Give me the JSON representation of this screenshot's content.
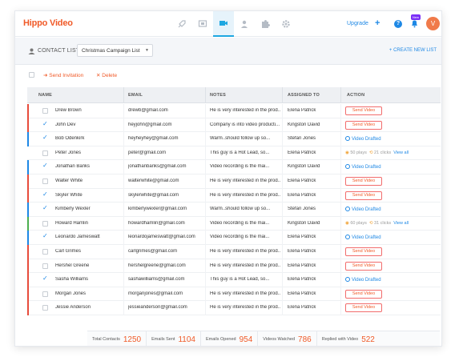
{
  "app": {
    "logo": "Hippo Video"
  },
  "topbar": {
    "nav_icons": [
      "rocket-icon",
      "screen-icon",
      "video-camera-icon",
      "contacts-icon",
      "puzzle-icon",
      "gear-icon"
    ],
    "upgrade": "Upgrade",
    "add": "+",
    "help": "?",
    "new_badge": "New",
    "avatar": "V",
    "accent": "#1ea7e1",
    "brand": "#f05a28"
  },
  "subheader": {
    "contact_list_label": "CONTACT LIST",
    "selected_list": "Christmas Campaign List",
    "create_new": "+ CREATE NEW LIST"
  },
  "actions": {
    "send_invitation": "Send Invitation",
    "delete": "Delete"
  },
  "table": {
    "columns": [
      "NAME",
      "EMAIL",
      "NOTES",
      "ASSIGNED TO",
      "ACTION"
    ],
    "rows": [
      {
        "name": "Drew Brown",
        "email": "drewb@gmail.com",
        "notes": "He is very interested in the prod...",
        "assigned": "Elena Patrick",
        "checked": false,
        "action": "send",
        "bar": "#e74c3c"
      },
      {
        "name": "John Dev",
        "email": "heyjohn@gmail.com",
        "notes": "Company is into video producti...",
        "assigned": "Kingston David",
        "checked": true,
        "action": "send",
        "bar": "#e74c3c"
      },
      {
        "name": "Bob Odenkirk",
        "email": "heyheyhey@gmail.com",
        "notes": "Warm..should follow up so...",
        "assigned": "Stefan Jones",
        "checked": true,
        "action": "drafted",
        "bar": "#1e88e5"
      },
      {
        "name": "Peter Jones",
        "email": "peter@gmail.com",
        "notes": "This guy is a Hot Lead, so...",
        "assigned": "Elena Patrick",
        "checked": false,
        "action": "stats",
        "plays": "50 plays",
        "clicks": "21 clicks",
        "bar": ""
      },
      {
        "name": "Jonathan Banks",
        "email": "jonathanbanks@gmail.com",
        "notes": "Video recording is the mai...",
        "assigned": "Kingston David",
        "checked": true,
        "action": "drafted",
        "bar": "#1e88e5"
      },
      {
        "name": "Walter White",
        "email": "walterwhite@gmail.com",
        "notes": "He is very interested in the prod...",
        "assigned": "Elena Patrick",
        "checked": false,
        "action": "send",
        "bar": "#e74c3c"
      },
      {
        "name": "Skyler White",
        "email": "skylerwhite@gmail.com",
        "notes": "He is very interested in the prod...",
        "assigned": "Elena Patrick",
        "checked": true,
        "action": "send",
        "bar": "#e74c3c"
      },
      {
        "name": "Kimberly Wexler",
        "email": "kimberlywexler@gmail.com",
        "notes": "Warm..should follow up so...",
        "assigned": "Stefan Jones",
        "checked": true,
        "action": "drafted",
        "bar": "#1e88e5"
      },
      {
        "name": "Howard Hamlin",
        "email": "howardhamlin@gmail.com",
        "notes": "Video recording is the mai...",
        "assigned": "Kingston David",
        "checked": false,
        "action": "stats",
        "plays": "60 plays",
        "clicks": "31 clicks",
        "bar": "#4caf50"
      },
      {
        "name": "Leonardo Jameswatt",
        "email": "leonardojameswatt@gmail.com",
        "notes": "Video recording is the mai...",
        "assigned": "Elena Patrick",
        "checked": true,
        "action": "drafted",
        "bar": "#1e88e5"
      },
      {
        "name": "Carl Grimes",
        "email": "carlgrimes@gmail.com",
        "notes": "He is very interested in the prod...",
        "assigned": "Elena Patrick",
        "checked": false,
        "action": "send",
        "bar": "#e74c3c"
      },
      {
        "name": "Hershel Greene",
        "email": "hershelgreene@gmail.com",
        "notes": "He is very interested in the prod...",
        "assigned": "Elena Patrick",
        "checked": false,
        "action": "send",
        "bar": "#e74c3c"
      },
      {
        "name": "Sasha Williams",
        "email": "sashawilliams@gmail.com",
        "notes": "This guy is a Hot Lead, so...",
        "assigned": "Elena Patrick",
        "checked": true,
        "action": "drafted",
        "bar": "#e74c3c"
      },
      {
        "name": "Morgan Jones",
        "email": "morganjones@gmail.com",
        "notes": "He is very interested in the prod...",
        "assigned": "Elena Patrick",
        "checked": false,
        "action": "send",
        "bar": "#e74c3c"
      },
      {
        "name": "Jessie Anderson",
        "email": "jessieanderson@gmail.com",
        "notes": "He is very interested in the prod...",
        "assigned": "Elena Patrick",
        "checked": false,
        "action": "send",
        "bar": "#e74c3c"
      }
    ],
    "send_label": "Send Video",
    "drafted_label": "Video Drafted",
    "view_all": "View all"
  },
  "footer": {
    "stats": [
      {
        "label": "Total Contacts",
        "value": "1250"
      },
      {
        "label": "Emails Sent",
        "value": "1104"
      },
      {
        "label": "Emails Opened",
        "value": "954"
      },
      {
        "label": "Videos Watched",
        "value": "786"
      },
      {
        "label": "Replied with Video",
        "value": "522"
      }
    ]
  }
}
